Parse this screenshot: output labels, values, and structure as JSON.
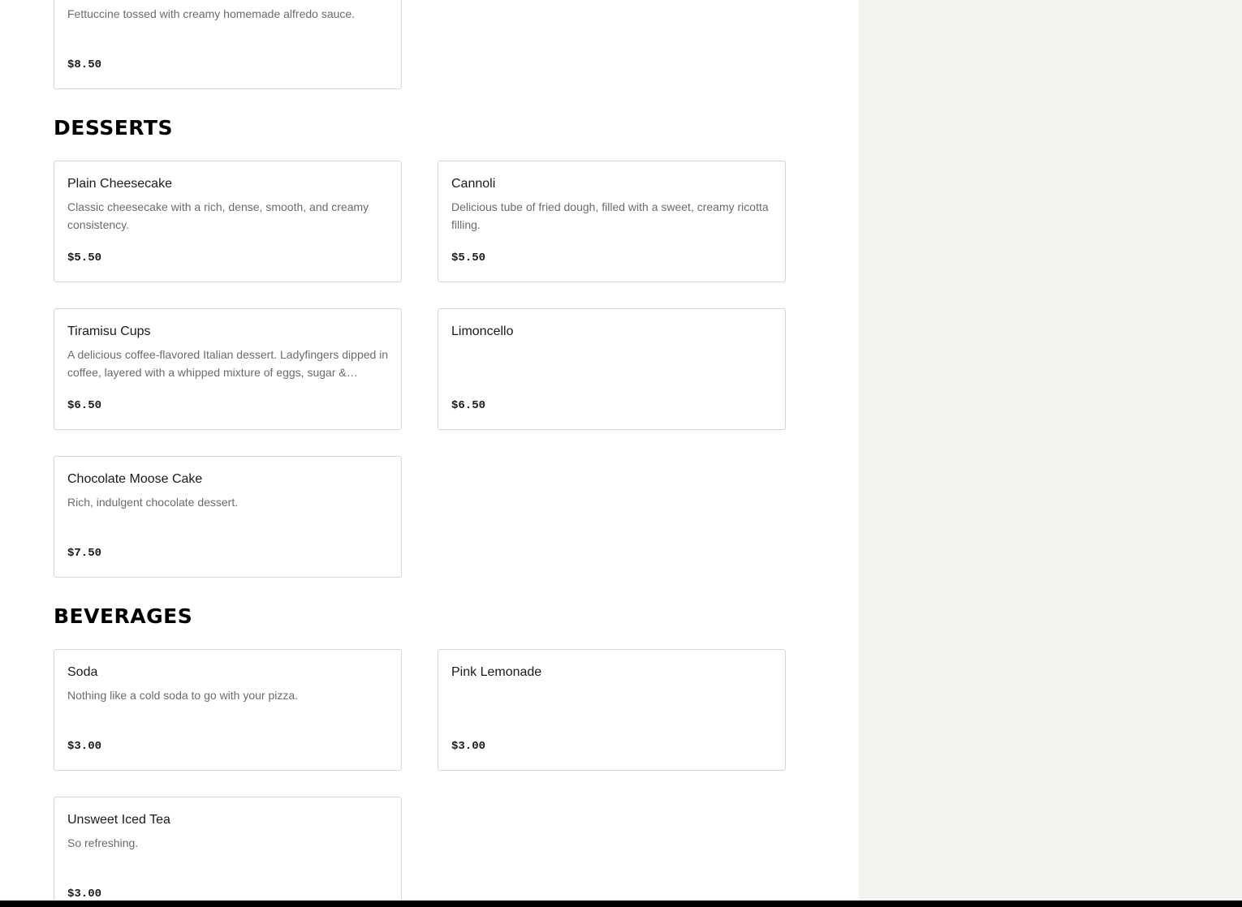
{
  "top_partial_item": {
    "description": "Fettuccine tossed with creamy homemade alfredo sauce.",
    "price": "$8.50"
  },
  "sections": [
    {
      "heading": "DESSERTS",
      "items": [
        {
          "name": "Plain Cheesecake",
          "description": "Classic cheesecake with a rich, dense, smooth, and creamy consistency.",
          "price": "$5.50"
        },
        {
          "name": "Cannoli",
          "description": "Delicious tube of fried dough, filled with a sweet, creamy ricotta filling.",
          "price": "$5.50"
        },
        {
          "name": "Tiramisu Cups",
          "description": "A delicious coffee-flavored Italian dessert. Ladyfingers dipped in coffee, layered with a whipped mixture of eggs, sugar &…",
          "price": "$6.50"
        },
        {
          "name": "Limoncello",
          "description": "",
          "price": "$6.50"
        },
        {
          "name": "Chocolate Moose Cake",
          "description": "Rich, indulgent chocolate dessert.",
          "price": "$7.50"
        }
      ]
    },
    {
      "heading": "BEVERAGES",
      "items": [
        {
          "name": "Soda",
          "description": "Nothing like a cold soda to go with your pizza.",
          "price": "$3.00"
        },
        {
          "name": "Pink Lemonade",
          "description": "",
          "price": "$3.00"
        },
        {
          "name": "Unsweet Iced Tea",
          "description": "So refreshing.",
          "price": "$3.00"
        }
      ]
    }
  ]
}
